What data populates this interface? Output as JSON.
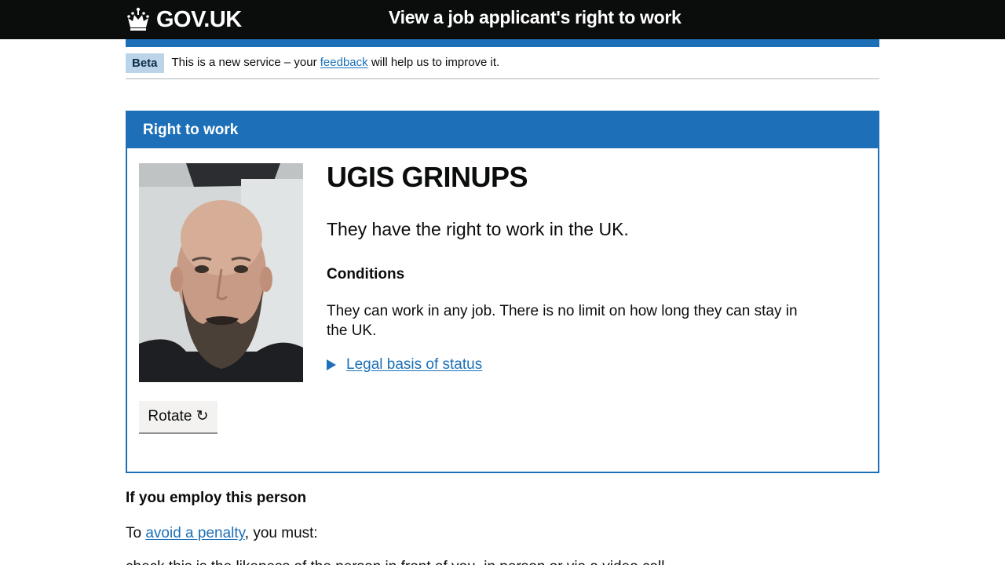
{
  "header": {
    "logo_text": "GOV.UK",
    "service_name": "View a job applicant's right to work"
  },
  "phase_banner": {
    "tag": "Beta",
    "text_before": "This is a new service – your",
    "link": "feedback",
    "text_after": "will help us to improve it."
  },
  "panel": {
    "heading": "Right to work",
    "name": "UGIS GRINUPS",
    "status": "They have the right to work in the UK.",
    "conditions_heading": "Conditions",
    "conditions_text": "They can work in any job. There is no limit on how long they can stay in the UK.",
    "details_summary": "Legal basis of status",
    "rotate_button": "Rotate ↻"
  },
  "employ": {
    "heading": "If you employ this person",
    "text_before": "To",
    "link": "avoid a penalty",
    "text_after": ", you must:",
    "first_item": "check this is the likeness of the person in front of you, in person or via a video call"
  },
  "colors": {
    "header_bg": "#0b0c0c",
    "brand_blue": "#1d70b8",
    "phase_tag_bg": "#bbd4ea",
    "button_bg": "#f3f2f1"
  }
}
